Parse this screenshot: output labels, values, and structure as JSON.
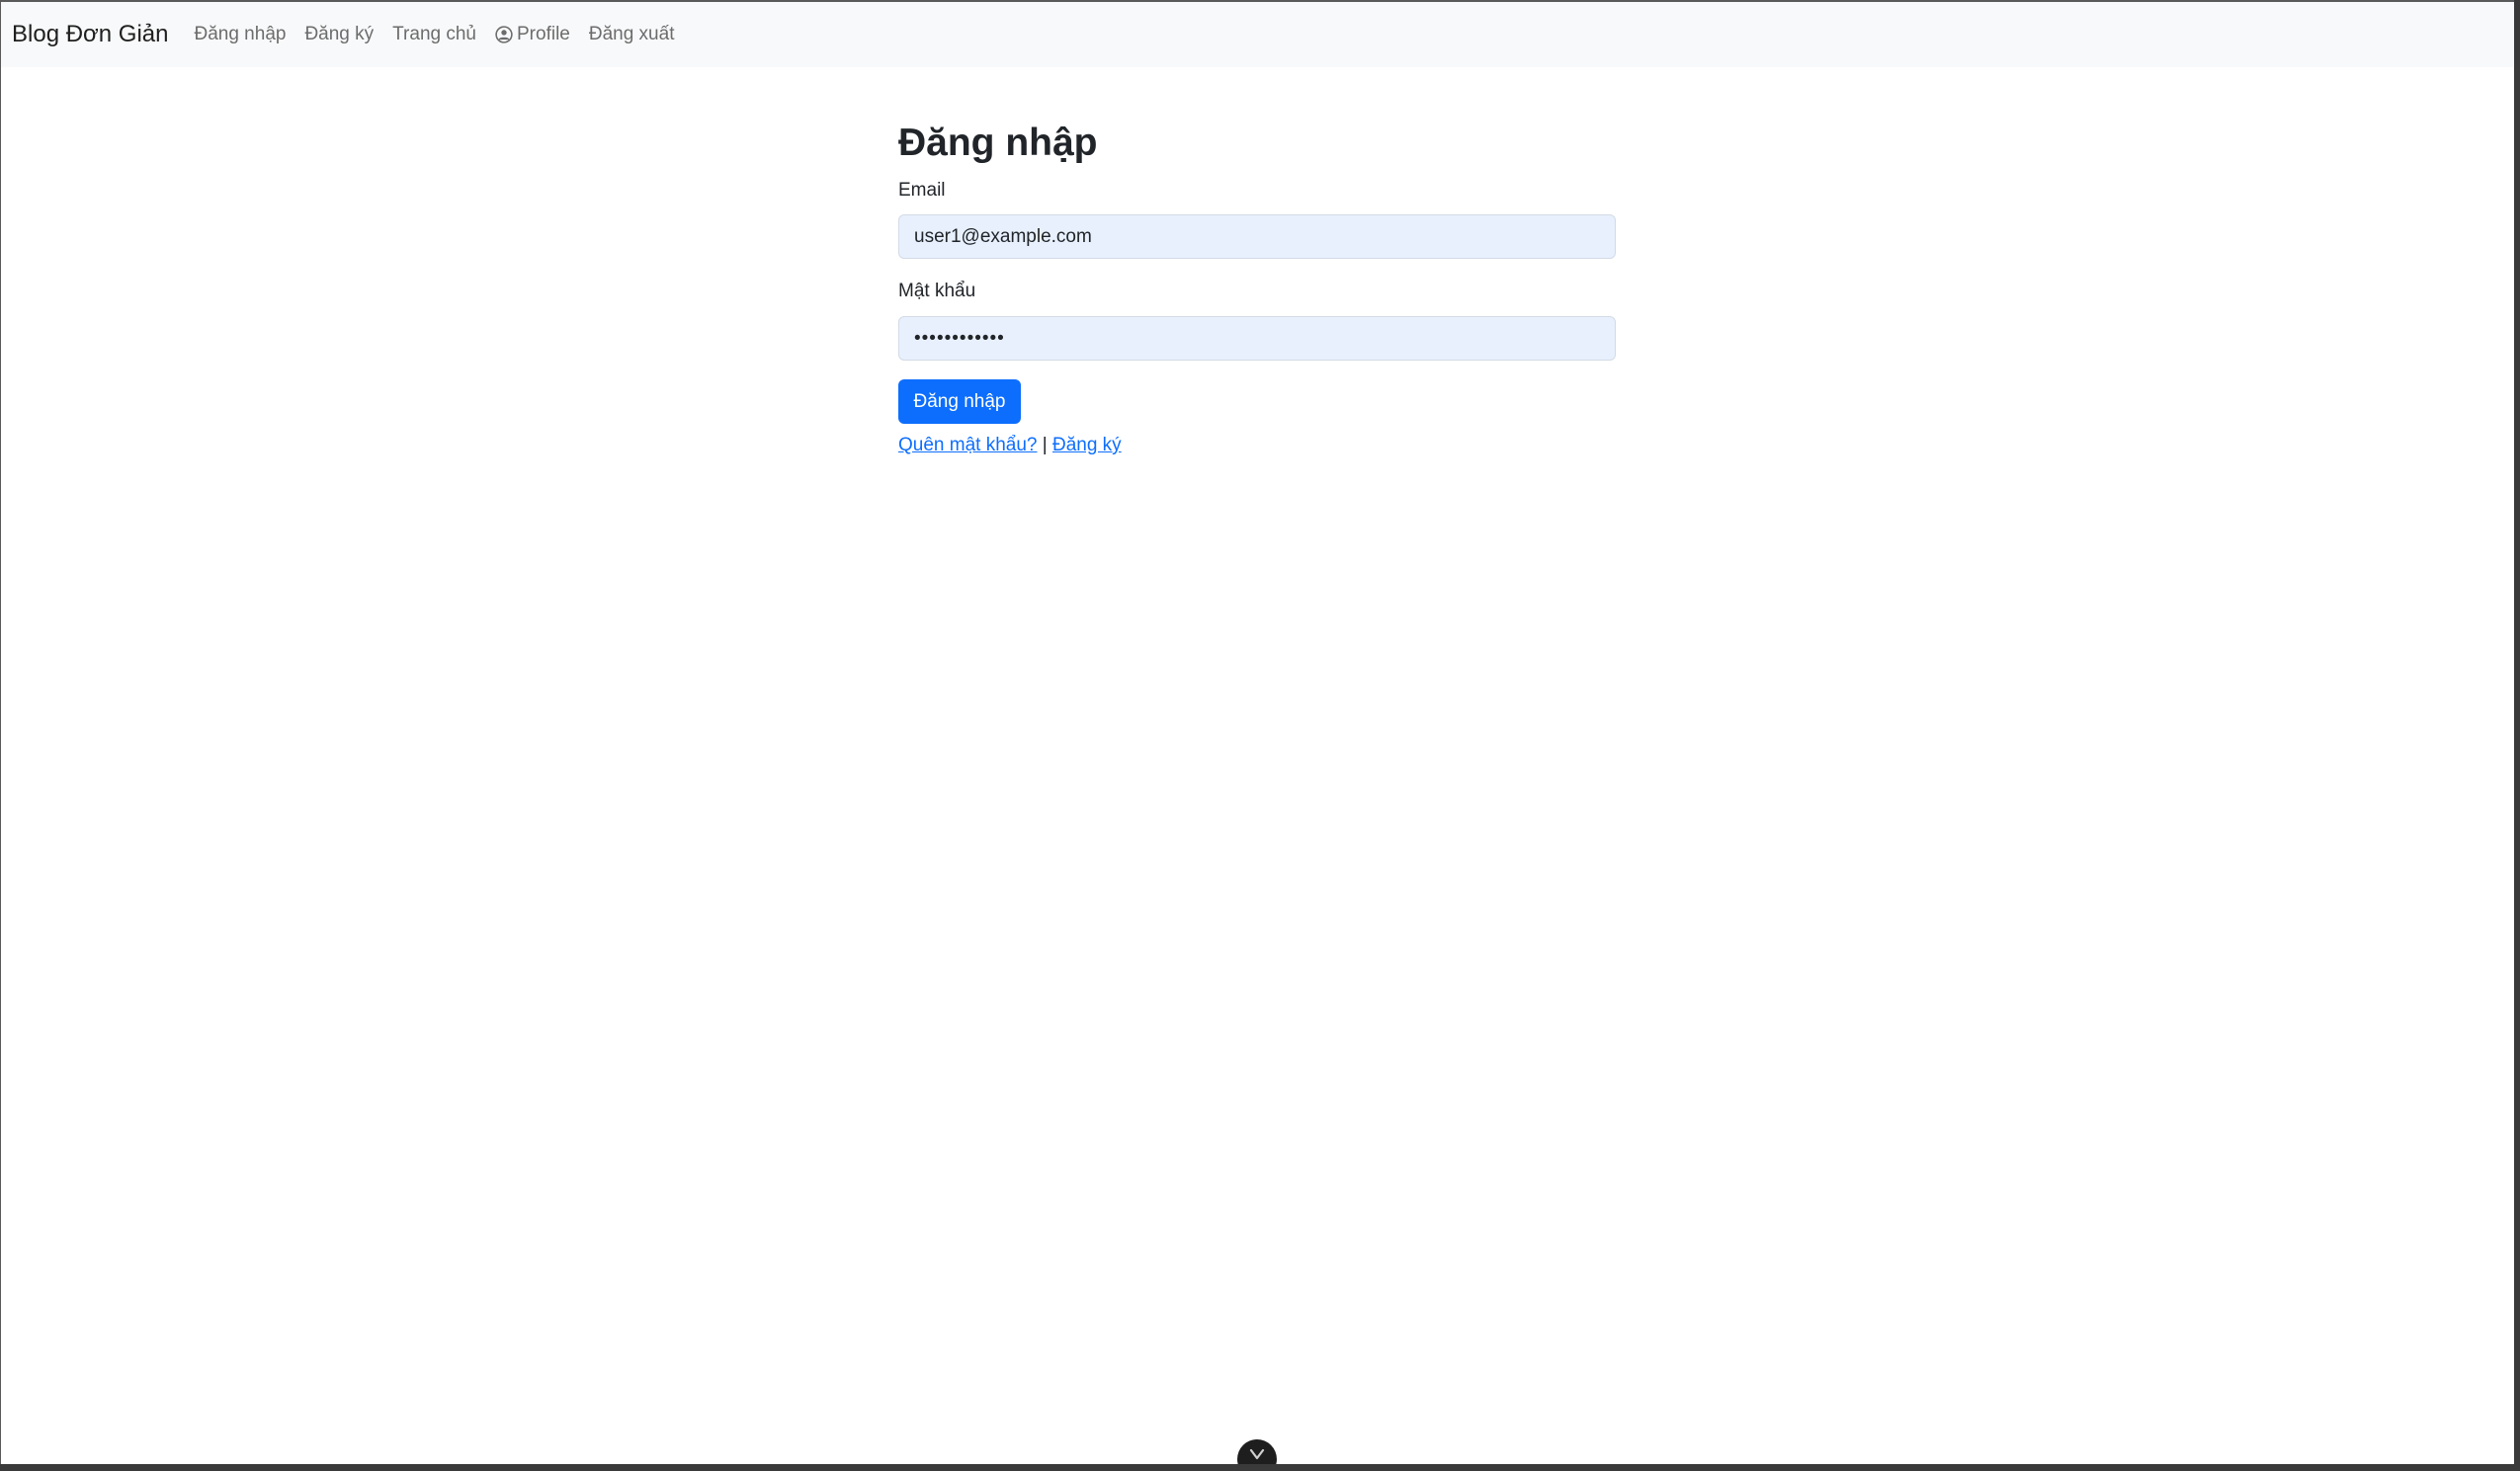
{
  "navbar": {
    "brand": "Blog Đơn Giản",
    "links": {
      "login": "Đăng nhập",
      "register": "Đăng ký",
      "home": "Trang chủ",
      "profile": "Profile",
      "logout": "Đăng xuất"
    },
    "profile_icon": "user-circle-icon"
  },
  "form": {
    "title": "Đăng nhập",
    "email_label": "Email",
    "email_value": "user1@example.com",
    "password_label": "Mật khẩu",
    "password_value": "••••••••••••",
    "submit_label": "Đăng nhập",
    "forgot_link": "Quên mật khẩu?",
    "separator": "|",
    "register_link": "Đăng ký"
  },
  "overlay": {
    "toggle_icon": "chevron-down-icon"
  },
  "colors": {
    "primary": "#0d6efd",
    "navbar_bg": "#f8f9fa",
    "input_autofill_bg": "#e8f0fe"
  }
}
